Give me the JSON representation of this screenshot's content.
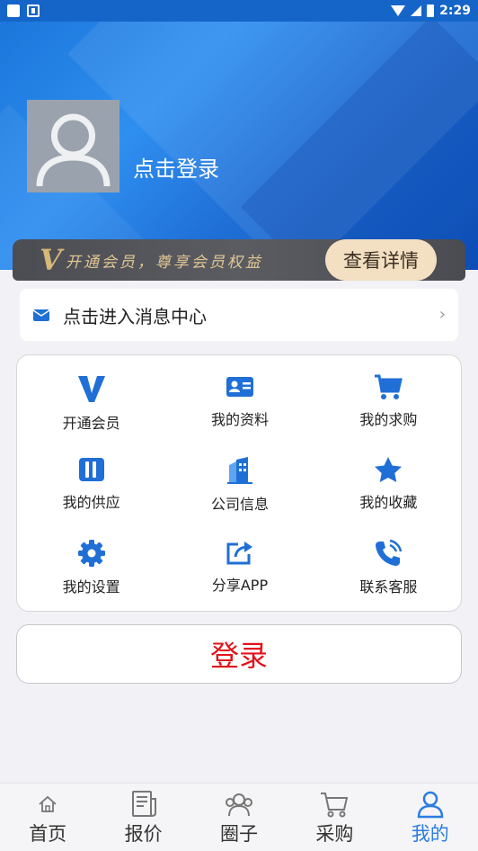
{
  "status_bar": {
    "time": "2:29"
  },
  "profile": {
    "login_prompt": "点击登录"
  },
  "vip_banner": {
    "v_mark": "V",
    "text": "开通会员，尊享会员权益",
    "button": "查看详情"
  },
  "message_center": {
    "label": "点击进入消息中心",
    "arrow": "›"
  },
  "grid": {
    "items": [
      {
        "label": "开通会员",
        "icon": "vip-v-icon"
      },
      {
        "label": "我的资料",
        "icon": "id-card-icon"
      },
      {
        "label": "我的求购",
        "icon": "cart-icon"
      },
      {
        "label": "我的供应",
        "icon": "supply-icon"
      },
      {
        "label": "公司信息",
        "icon": "building-icon"
      },
      {
        "label": "我的收藏",
        "icon": "star-icon"
      },
      {
        "label": "我的设置",
        "icon": "gear-icon"
      },
      {
        "label": "分享APP",
        "icon": "share-icon"
      },
      {
        "label": "联系客服",
        "icon": "phone-icon"
      }
    ]
  },
  "login_button": {
    "label": "登录"
  },
  "bottom_nav": {
    "items": [
      {
        "label": "首页",
        "icon": "home-icon"
      },
      {
        "label": "报价",
        "icon": "quote-icon"
      },
      {
        "label": "圈子",
        "icon": "circle-icon"
      },
      {
        "label": "采购",
        "icon": "purchase-cart-icon"
      },
      {
        "label": "我的",
        "icon": "person-icon",
        "active": true
      }
    ]
  },
  "colors": {
    "accent": "#2a7de1",
    "icon_blue": "#1f6fd6",
    "login_red": "#e0141a",
    "vip_gold": "#d8b77a"
  }
}
